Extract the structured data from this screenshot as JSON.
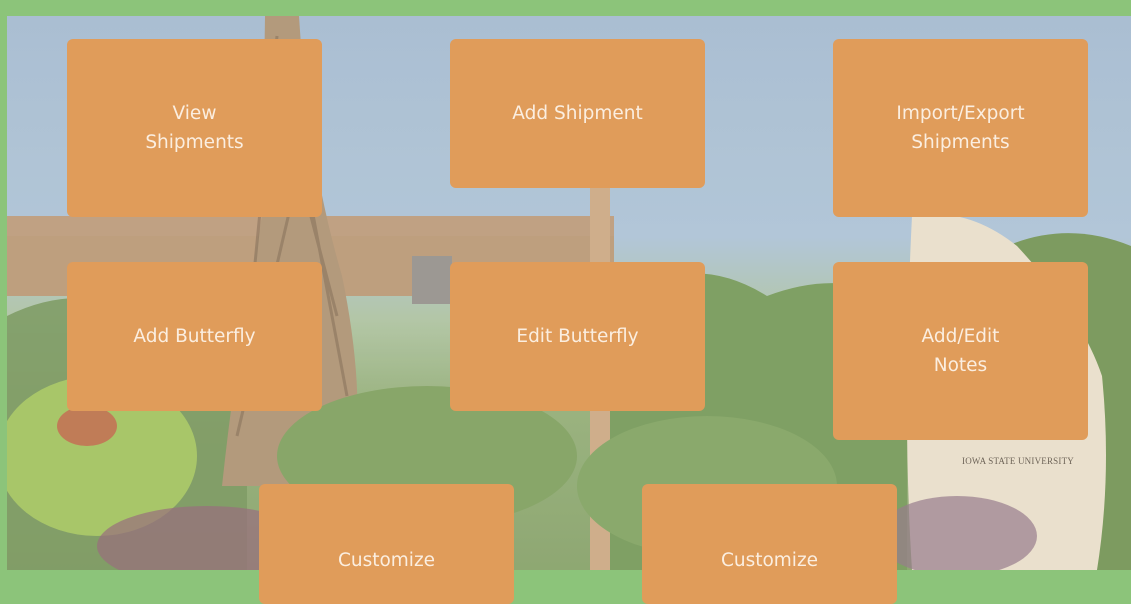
{
  "tiles": {
    "view_shipments": "View\nShipments",
    "add_shipment": "Add Shipment",
    "import_export_shipments": "Import/Export\nShipments",
    "add_butterfly": "Add Butterfly",
    "edit_butterfly": "Edit Butterfly",
    "add_edit_notes": "Add/Edit\nNotes",
    "customize_1": "Customize",
    "customize_2": "Customize"
  },
  "background": {
    "sign_text": "IOWA STATE UNIVERSITY"
  },
  "colors": {
    "frame": "#8cc47a",
    "tile": "#e09c5a",
    "tile_text": "#fbeee0"
  }
}
